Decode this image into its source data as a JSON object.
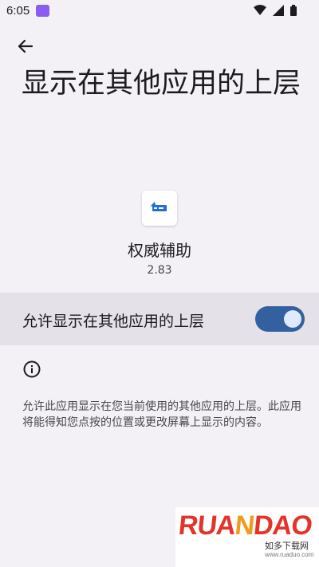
{
  "status_bar": {
    "time": "6:05"
  },
  "header": {
    "title": "显示在其他应用的上层"
  },
  "app": {
    "name": "权威辅助",
    "version": "2.83"
  },
  "permission": {
    "label": "允许显示在其他应用的上层",
    "enabled": true
  },
  "info": {
    "description": "允许此应用显示在您当前使用的其他应用的上层。此应用将能得知您点按的位置或更改屏幕上显示的内容。"
  },
  "watermark": {
    "logo_text": "RUANDAO",
    "subtitle": "如多下载网",
    "url": "www.ruaduo.com"
  },
  "colors": {
    "background": "#f3f1f5",
    "toggle_on": "#33609e",
    "highlight_row": "#e4e1e8"
  }
}
